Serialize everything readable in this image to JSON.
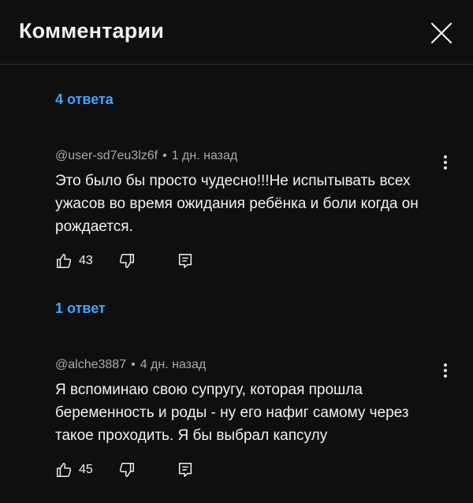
{
  "header": {
    "title": "Комментарии"
  },
  "threads": [
    {
      "replies_label": "4 ответа",
      "comment": {
        "author": "@user-sd7eu3lz6f",
        "time": "1 дн. назад",
        "text": "Это было бы просто чудесно!!!Не испытывать всех ужасов во время ожидания ребёнка и боли когда он рождается.",
        "likes": "43"
      }
    },
    {
      "replies_label": "1 ответ",
      "comment": {
        "author": "@alche3887",
        "time": "4 дн. назад",
        "text": "Я вспоминаю свою супругу, которая прошла беременность и роды - ну его нафиг самому через такое проходить. Я бы выбрал капсулу",
        "likes": "45"
      }
    }
  ],
  "meta_separator": "•",
  "colors": {
    "background": "#0f0f0f",
    "link": "#3ea6ff",
    "meta": "#aaaaaa",
    "text": "#f1f1f1"
  },
  "icons": {
    "close": "close-icon",
    "more": "more-vert-icon",
    "like": "thumb-up-icon",
    "dislike": "thumb-down-icon",
    "reply": "reply-icon"
  }
}
